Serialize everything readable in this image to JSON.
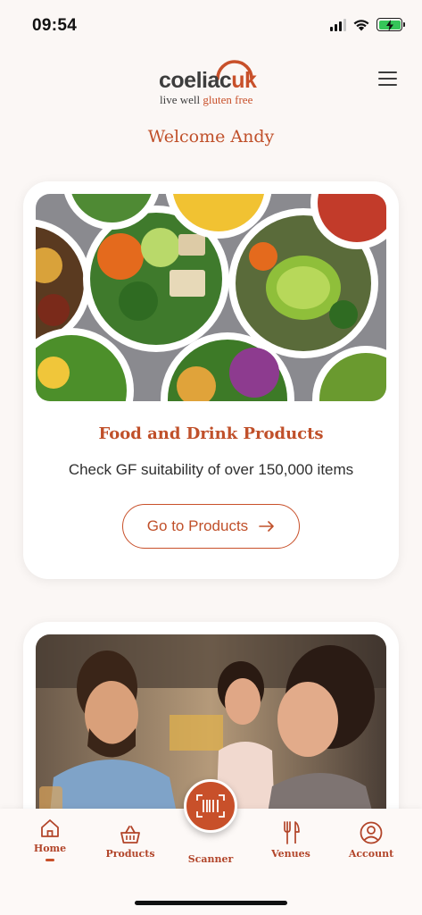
{
  "status_bar": {
    "time": "09:54"
  },
  "header": {
    "logo_word": "coeliac",
    "logo_uk": "uk",
    "logo_tag_a": "live well",
    "logo_tag_b": "gluten free"
  },
  "welcome": "Welcome Andy",
  "cards": [
    {
      "title": "Food and Drink Products",
      "subtitle": "Check GF suitability of over 150,000 items",
      "cta": "Go to Products",
      "image": "salad-bowls-photo"
    },
    {
      "image": "friends-dining-photo"
    }
  ],
  "tab_bar": {
    "tabs": [
      {
        "label": "Home",
        "icon": "home-icon",
        "active": true
      },
      {
        "label": "Products",
        "icon": "basket-icon"
      },
      {
        "label": "Scanner",
        "icon": "barcode-icon"
      },
      {
        "label": "Venues",
        "icon": "cutlery-icon"
      },
      {
        "label": "Account",
        "icon": "user-icon"
      }
    ]
  },
  "colors": {
    "brand": "#c8502a",
    "background": "#fbf7f5",
    "battery": "#35c559"
  }
}
